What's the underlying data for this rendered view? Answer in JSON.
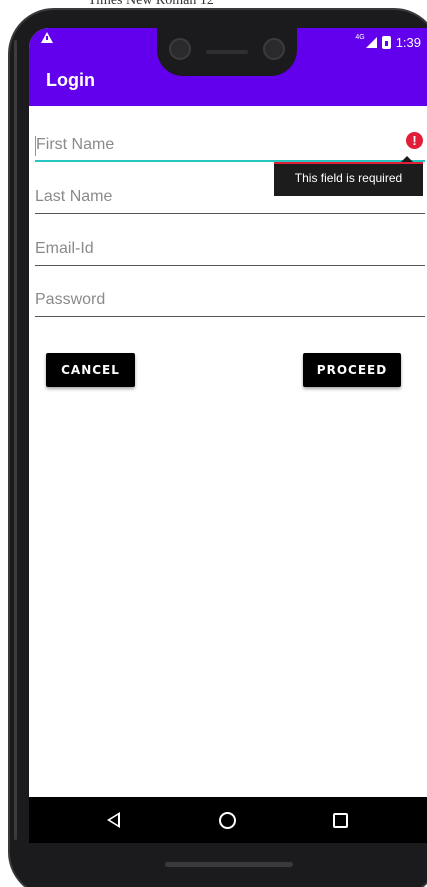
{
  "background_clip_text": "Times New Roman   12",
  "status_bar": {
    "network_type": "4G",
    "time": "1:39",
    "warning_icon": "warning-icon",
    "signal_icon": "signal-icon",
    "battery_icon": "battery-icon"
  },
  "app_bar": {
    "title": "Login",
    "color": "#6200ee"
  },
  "form": {
    "first_name": {
      "placeholder": "First Name",
      "focused": true,
      "error_icon": "!"
    },
    "last_name": {
      "placeholder": "Last Name"
    },
    "email": {
      "placeholder": "Email-Id"
    },
    "password": {
      "placeholder": "Password"
    }
  },
  "error_tooltip": {
    "text": "This field is required",
    "color": "#e01e37"
  },
  "buttons": {
    "cancel_label": "CANCEL",
    "proceed_label": "PROCEED"
  },
  "nav_bar": {
    "back_icon": "back-triangle-icon",
    "home_icon": "home-circle-icon",
    "recents_icon": "recents-square-icon"
  },
  "accent_color": "#26c6c0"
}
